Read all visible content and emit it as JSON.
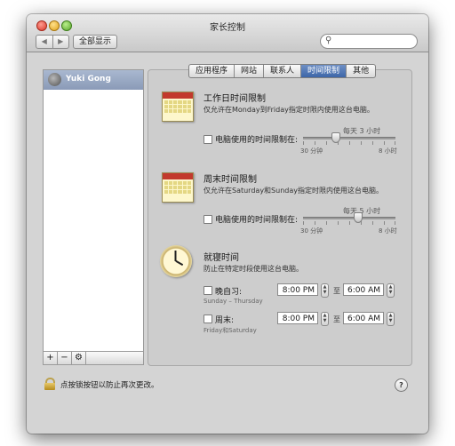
{
  "window": {
    "title": "家长控制"
  },
  "toolbar": {
    "back_glyph": "◀",
    "forward_glyph": "▶",
    "show_all_label": "全部显示",
    "search_placeholder": ""
  },
  "sidebar": {
    "users": [
      {
        "name": "Yuki Gong"
      }
    ],
    "buttons": {
      "add": "+",
      "remove": "−",
      "action": "⚙"
    }
  },
  "tabs": [
    {
      "label": "应用程序",
      "active": false
    },
    {
      "label": "网站",
      "active": false
    },
    {
      "label": "联系人",
      "active": false
    },
    {
      "label": "时间限制",
      "active": true
    },
    {
      "label": "其他",
      "active": false
    }
  ],
  "weekday": {
    "title": "工作日时间限制",
    "description": "仅允许在Monday到Friday指定时限内使用这台电脑。",
    "checkbox_label": "电脑使用的时间限制在:",
    "checked": false,
    "slider_value_label": "每天 3 小时",
    "slider_hours": 3,
    "slider_min_label": "30 分钟",
    "slider_max_label": "8 小时"
  },
  "weekend": {
    "title": "周末时间限制",
    "description": "仅允许在Saturday和Sunday指定时限内使用这台电脑。",
    "checkbox_label": "电脑使用的时间限制在:",
    "checked": false,
    "slider_value_label": "每天 5 小时",
    "slider_hours": 5,
    "slider_min_label": "30 分钟",
    "slider_max_label": "8 小时"
  },
  "bedtime": {
    "title": "就寝时间",
    "description": "防止在特定时段使用这台电脑。",
    "school_nights": {
      "label": "晚自习:",
      "days": "Sunday – Thursday",
      "from": "8:00 PM",
      "to_label": "至",
      "to": "6:00 AM",
      "checked": false
    },
    "weekend": {
      "label": "周末:",
      "days": "Friday和Saturday",
      "from": "8:00 PM",
      "to_label": "至",
      "to": "6:00 AM",
      "checked": false
    }
  },
  "footer": {
    "lock_text": "点按锁按钮以防止再次更改。",
    "help_label": "?"
  },
  "icons": {
    "search": "magnifier-icon",
    "lock": "lock-icon",
    "calendar": "calendar-icon",
    "clock": "clock-icon"
  }
}
